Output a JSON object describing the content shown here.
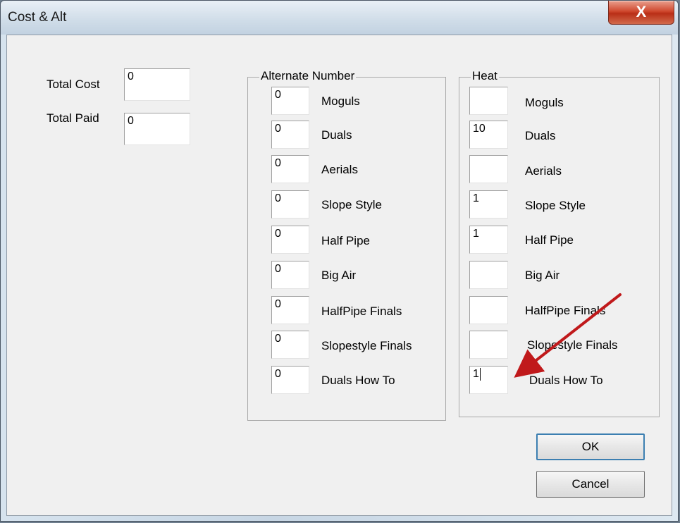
{
  "window": {
    "title": "Cost & Alt",
    "close_glyph": "X"
  },
  "cost": {
    "total_cost_label": "Total Cost",
    "total_cost_value": "0",
    "total_paid_label": "Total Paid",
    "total_paid_value": "0"
  },
  "alternate": {
    "title": "Alternate Number",
    "rows": [
      {
        "label": "Moguls",
        "value": "0"
      },
      {
        "label": "Duals",
        "value": "0"
      },
      {
        "label": "Aerials",
        "value": "0"
      },
      {
        "label": "Slope Style",
        "value": "0"
      },
      {
        "label": "Half Pipe",
        "value": "0"
      },
      {
        "label": "Big Air",
        "value": "0"
      },
      {
        "label": "HalfPipe Finals",
        "value": "0"
      },
      {
        "label": "Slopestyle Finals",
        "value": "0"
      },
      {
        "label": "Duals How To",
        "value": "0"
      }
    ]
  },
  "heat": {
    "title": "Heat",
    "rows": [
      {
        "label": "Moguls",
        "value": ""
      },
      {
        "label": "Duals",
        "value": "10"
      },
      {
        "label": "Aerials",
        "value": ""
      },
      {
        "label": "Slope Style",
        "value": "1"
      },
      {
        "label": "Half Pipe",
        "value": "1"
      },
      {
        "label": "Big Air",
        "value": ""
      },
      {
        "label": "HalfPipe Finals",
        "value": ""
      },
      {
        "label": "Slopestyle Finals",
        "value": ""
      },
      {
        "label": "Duals How To",
        "value": "1"
      }
    ]
  },
  "buttons": {
    "ok": "OK",
    "cancel": "Cancel"
  },
  "annotation": {
    "arrow_color": "#c0191b"
  }
}
